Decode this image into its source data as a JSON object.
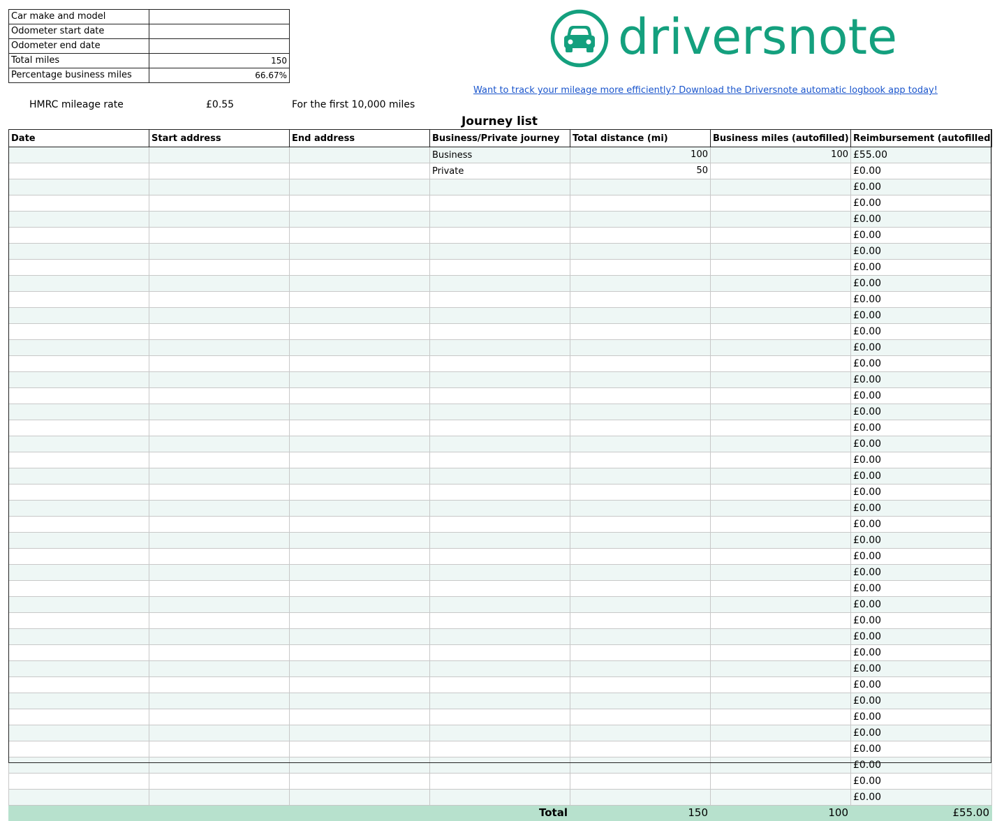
{
  "vehicle_info": [
    {
      "label": "Car make and model",
      "value": ""
    },
    {
      "label": "Odometer start date",
      "value": ""
    },
    {
      "label": "Odometer end date",
      "value": ""
    },
    {
      "label": "Total miles",
      "value": "150"
    },
    {
      "label": "Percentage business miles",
      "value": "66.67%"
    }
  ],
  "brand": {
    "name": "driversnote",
    "color": "#14a07e",
    "icon": "car-icon",
    "promo_link": "Want to track your mileage more efficiently? Download the Driversnote automatic logbook app today!"
  },
  "rate": {
    "label": "HMRC mileage rate",
    "value": "£0.55",
    "note": "For the first 10,000 miles"
  },
  "journey": {
    "title": "Journey list",
    "columns": [
      "Date",
      "Start address",
      "End address",
      "Business/Private journey",
      "Total distance (mi)",
      "Business miles (autofilled)",
      "Reimbursement (autofilled)"
    ],
    "rows": [
      {
        "date": "",
        "start": "",
        "end": "",
        "type": "Business",
        "distance": "100",
        "business_miles": "100",
        "reimbursement": "£55.00"
      },
      {
        "date": "",
        "start": "",
        "end": "",
        "type": "Private",
        "distance": "50",
        "business_miles": "",
        "reimbursement": "£0.00"
      },
      {
        "date": "",
        "start": "",
        "end": "",
        "type": "",
        "distance": "",
        "business_miles": "",
        "reimbursement": "£0.00"
      },
      {
        "date": "",
        "start": "",
        "end": "",
        "type": "",
        "distance": "",
        "business_miles": "",
        "reimbursement": "£0.00"
      },
      {
        "date": "",
        "start": "",
        "end": "",
        "type": "",
        "distance": "",
        "business_miles": "",
        "reimbursement": "£0.00"
      },
      {
        "date": "",
        "start": "",
        "end": "",
        "type": "",
        "distance": "",
        "business_miles": "",
        "reimbursement": "£0.00"
      },
      {
        "date": "",
        "start": "",
        "end": "",
        "type": "",
        "distance": "",
        "business_miles": "",
        "reimbursement": "£0.00"
      },
      {
        "date": "",
        "start": "",
        "end": "",
        "type": "",
        "distance": "",
        "business_miles": "",
        "reimbursement": "£0.00"
      },
      {
        "date": "",
        "start": "",
        "end": "",
        "type": "",
        "distance": "",
        "business_miles": "",
        "reimbursement": "£0.00"
      },
      {
        "date": "",
        "start": "",
        "end": "",
        "type": "",
        "distance": "",
        "business_miles": "",
        "reimbursement": "£0.00"
      },
      {
        "date": "",
        "start": "",
        "end": "",
        "type": "",
        "distance": "",
        "business_miles": "",
        "reimbursement": "£0.00"
      },
      {
        "date": "",
        "start": "",
        "end": "",
        "type": "",
        "distance": "",
        "business_miles": "",
        "reimbursement": "£0.00"
      },
      {
        "date": "",
        "start": "",
        "end": "",
        "type": "",
        "distance": "",
        "business_miles": "",
        "reimbursement": "£0.00"
      },
      {
        "date": "",
        "start": "",
        "end": "",
        "type": "",
        "distance": "",
        "business_miles": "",
        "reimbursement": "£0.00"
      },
      {
        "date": "",
        "start": "",
        "end": "",
        "type": "",
        "distance": "",
        "business_miles": "",
        "reimbursement": "£0.00"
      },
      {
        "date": "",
        "start": "",
        "end": "",
        "type": "",
        "distance": "",
        "business_miles": "",
        "reimbursement": "£0.00"
      },
      {
        "date": "",
        "start": "",
        "end": "",
        "type": "",
        "distance": "",
        "business_miles": "",
        "reimbursement": "£0.00"
      },
      {
        "date": "",
        "start": "",
        "end": "",
        "type": "",
        "distance": "",
        "business_miles": "",
        "reimbursement": "£0.00"
      },
      {
        "date": "",
        "start": "",
        "end": "",
        "type": "",
        "distance": "",
        "business_miles": "",
        "reimbursement": "£0.00"
      },
      {
        "date": "",
        "start": "",
        "end": "",
        "type": "",
        "distance": "",
        "business_miles": "",
        "reimbursement": "£0.00"
      },
      {
        "date": "",
        "start": "",
        "end": "",
        "type": "",
        "distance": "",
        "business_miles": "",
        "reimbursement": "£0.00"
      },
      {
        "date": "",
        "start": "",
        "end": "",
        "type": "",
        "distance": "",
        "business_miles": "",
        "reimbursement": "£0.00"
      },
      {
        "date": "",
        "start": "",
        "end": "",
        "type": "",
        "distance": "",
        "business_miles": "",
        "reimbursement": "£0.00"
      },
      {
        "date": "",
        "start": "",
        "end": "",
        "type": "",
        "distance": "",
        "business_miles": "",
        "reimbursement": "£0.00"
      },
      {
        "date": "",
        "start": "",
        "end": "",
        "type": "",
        "distance": "",
        "business_miles": "",
        "reimbursement": "£0.00"
      },
      {
        "date": "",
        "start": "",
        "end": "",
        "type": "",
        "distance": "",
        "business_miles": "",
        "reimbursement": "£0.00"
      },
      {
        "date": "",
        "start": "",
        "end": "",
        "type": "",
        "distance": "",
        "business_miles": "",
        "reimbursement": "£0.00"
      },
      {
        "date": "",
        "start": "",
        "end": "",
        "type": "",
        "distance": "",
        "business_miles": "",
        "reimbursement": "£0.00"
      },
      {
        "date": "",
        "start": "",
        "end": "",
        "type": "",
        "distance": "",
        "business_miles": "",
        "reimbursement": "£0.00"
      },
      {
        "date": "",
        "start": "",
        "end": "",
        "type": "",
        "distance": "",
        "business_miles": "",
        "reimbursement": "£0.00"
      },
      {
        "date": "",
        "start": "",
        "end": "",
        "type": "",
        "distance": "",
        "business_miles": "",
        "reimbursement": "£0.00"
      },
      {
        "date": "",
        "start": "",
        "end": "",
        "type": "",
        "distance": "",
        "business_miles": "",
        "reimbursement": "£0.00"
      },
      {
        "date": "",
        "start": "",
        "end": "",
        "type": "",
        "distance": "",
        "business_miles": "",
        "reimbursement": "£0.00"
      },
      {
        "date": "",
        "start": "",
        "end": "",
        "type": "",
        "distance": "",
        "business_miles": "",
        "reimbursement": "£0.00"
      },
      {
        "date": "",
        "start": "",
        "end": "",
        "type": "",
        "distance": "",
        "business_miles": "",
        "reimbursement": "£0.00"
      },
      {
        "date": "",
        "start": "",
        "end": "",
        "type": "",
        "distance": "",
        "business_miles": "",
        "reimbursement": "£0.00"
      },
      {
        "date": "",
        "start": "",
        "end": "",
        "type": "",
        "distance": "",
        "business_miles": "",
        "reimbursement": "£0.00"
      },
      {
        "date": "",
        "start": "",
        "end": "",
        "type": "",
        "distance": "",
        "business_miles": "",
        "reimbursement": "£0.00"
      },
      {
        "date": "",
        "start": "",
        "end": "",
        "type": "",
        "distance": "",
        "business_miles": "",
        "reimbursement": "£0.00"
      },
      {
        "date": "",
        "start": "",
        "end": "",
        "type": "",
        "distance": "",
        "business_miles": "",
        "reimbursement": "£0.00"
      },
      {
        "date": "",
        "start": "",
        "end": "",
        "type": "",
        "distance": "",
        "business_miles": "",
        "reimbursement": "£0.00"
      }
    ],
    "totals": {
      "label": "Total",
      "distance": "150",
      "business_miles": "100",
      "reimbursement": "£55.00"
    },
    "row_colors": {
      "odd": "#eef7f5",
      "even": "#ffffff",
      "total": "#b7e1cd"
    }
  }
}
